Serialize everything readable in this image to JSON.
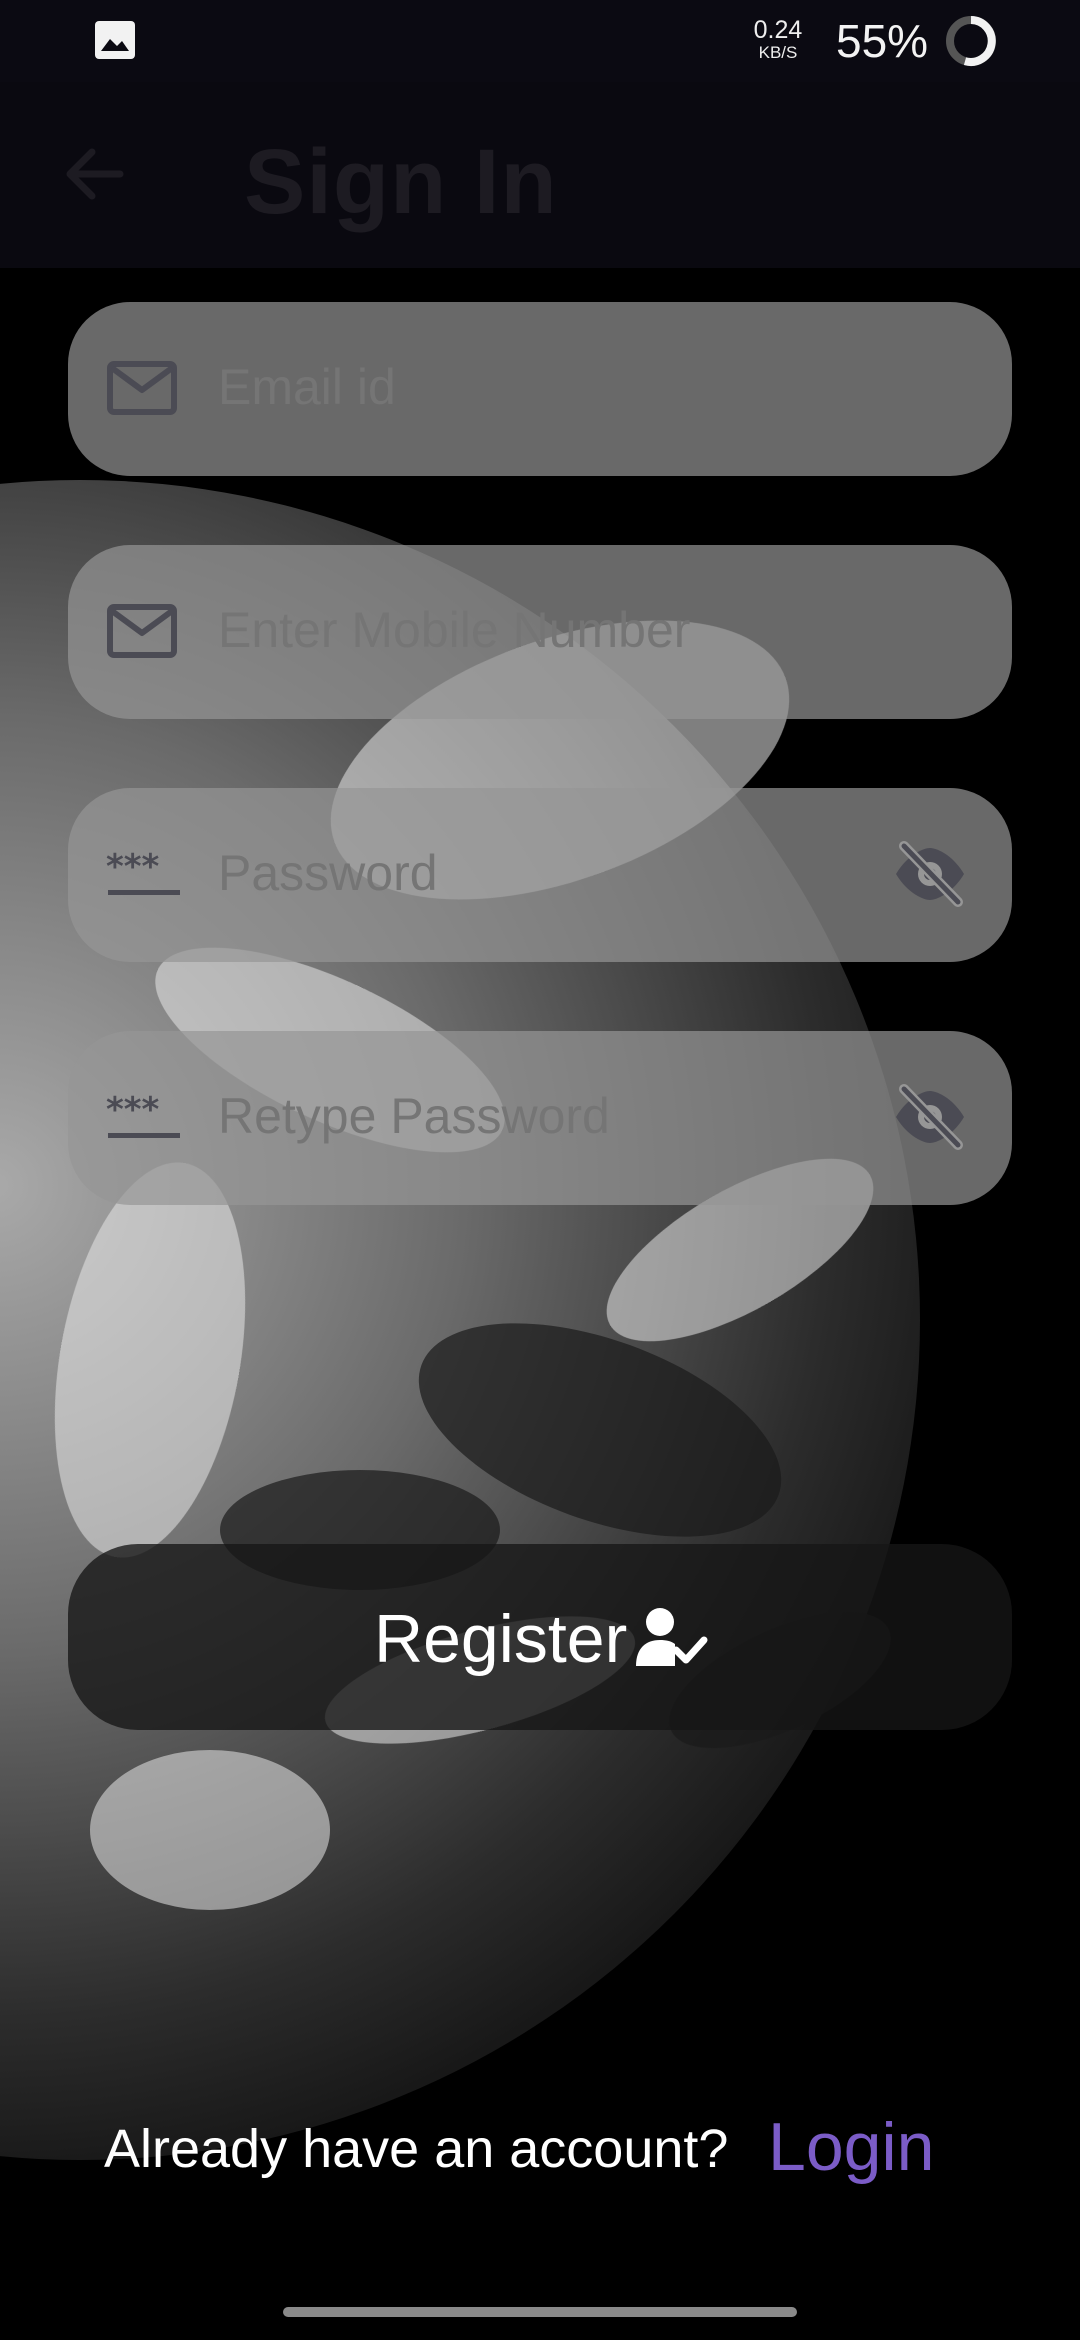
{
  "status_bar": {
    "speed_value": "0.24",
    "speed_unit": "KB/S",
    "battery": "55%",
    "icons": [
      "gallery-icon",
      "battery-ring-icon"
    ]
  },
  "app_bar": {
    "title": "Sign In",
    "back_icon": "arrow-left-icon"
  },
  "form": {
    "email_placeholder": "Email id",
    "mobile_placeholder": "Enter Mobile Number",
    "password_placeholder": "Password",
    "retype_placeholder": "Retype Password",
    "icons": [
      "mail-icon",
      "mail-icon",
      "password-dots-icon",
      "password-dots-icon",
      "eye-off-icon",
      "eye-off-icon"
    ]
  },
  "register": {
    "label": "Register",
    "icon": "person-check-icon"
  },
  "footer": {
    "prompt": "Already have an account?",
    "login_label": "Login"
  },
  "colors": {
    "accent": "#7b5cc7",
    "field_bg": "#969696",
    "background": "#000000"
  }
}
